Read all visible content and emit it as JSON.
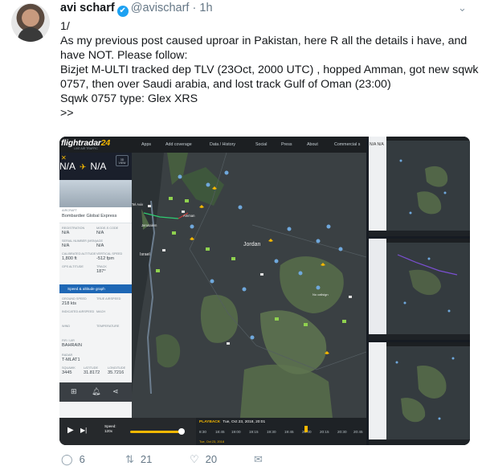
{
  "tweet": {
    "author_name": "avi scharf",
    "verified_glyph": "✔",
    "handle": "@avischarf",
    "separator": "·",
    "time": "1h",
    "caret_icon": "chevron-down-icon",
    "lines": [
      "1/",
      "As my previous post caused uproar in Pakistan, here R all the details i have, and",
      "have NOT. Please follow:",
      "Bizjet M-ULTI tracked dep TLV (23Oct, 2000 UTC) , hopped Amman, got new sqwk",
      "0757, then over Saudi arabia, and lost track Gulf of Oman (23:00)",
      "Sqwk 0757 type: Glex XRS",
      ">>"
    ]
  },
  "fr24": {
    "logo_text": "flightradar",
    "logo_num": "24",
    "tagline": "LIVE AIR TRAFFIC",
    "menu": [
      "Apps",
      "Add coverage",
      "Data / History",
      "Social",
      "Press",
      "About",
      "Commercial s"
    ],
    "map_labels": {
      "jordan": "Jordan",
      "amman": "Amman",
      "tel_aviv": "Tel Aviv",
      "jerusalem": "Jerusalem",
      "israel": "Israel",
      "no_callsign": "No callsign"
    },
    "panel": {
      "close_glyph": "✕",
      "view_3d": "3D VIEW",
      "origin": "N/A",
      "destination": "N/A",
      "arrow_glyph": "✈",
      "aircraft_label": "AIRCRAFT",
      "aircraft": "Bombardier Global Express",
      "fields": [
        {
          "label": "REGISTRATION",
          "value": "N/A"
        },
        {
          "label": "MODE-S CODE",
          "value": "N/A"
        },
        {
          "label": "SERIAL NUMBER (MSN)",
          "value": "N/A"
        },
        {
          "label": "AGE",
          "value": "N/A"
        },
        {
          "label": "CALIBRATED ALTITUDE",
          "value": "1,800 ft"
        },
        {
          "label": "VERTICAL SPEED",
          "value": "-512 fpm"
        },
        {
          "label": "GPS ALTITUDE",
          "value": ""
        },
        {
          "label": "TRACK",
          "value": "187°"
        }
      ],
      "speed_bar": "Speed & altitude graph",
      "ground_speed_label": "GROUND SPEED",
      "ground_speed": "218 kts",
      "true_airspeed_label": "TRUE AIRSPEED",
      "indicated_label": "INDICATED AIRSPEED",
      "mach_label": "MACH",
      "wind_label": "WIND",
      "temperature_label": "TEMPERATURE",
      "fir_label": "FIR / UIR",
      "fir_value": "BAHRAIN",
      "radar_label": "RADAR",
      "radar_value": "T-MLAT1",
      "squawk_label": "SQUAWK",
      "squawk": "3445",
      "latitude_label": "LATITUDE",
      "latitude": "31.8172",
      "longitude_label": "LONGITUDE",
      "longitude": "35.7216",
      "icons": [
        "grid-icon",
        "bell-icon",
        "share-icon"
      ]
    },
    "playback": {
      "play_glyph": "▶",
      "next_glyph": "▶|",
      "speed_label": "Speed:",
      "speed_value": "120x",
      "label": "PLAYBACK",
      "datetime": "Tue, Oct 23, 2018, 20:01",
      "ticks": [
        "8:30",
        "18:45",
        "19:00",
        "19:15",
        "19:30",
        "19:45",
        "20:00",
        "20:15",
        "20:30",
        "20:45"
      ],
      "date_small": "Tue, Oct 23, 2018"
    },
    "thumb_codes": "N/A    N/A"
  },
  "actions": {
    "reply_icon": "reply-icon",
    "reply_count": "6",
    "retweet_icon": "retweet-icon",
    "retweet_count": "21",
    "like_icon": "heart-icon",
    "like_count": "20",
    "message_icon": "envelope-icon"
  },
  "colors": {
    "accent": "#f5b800",
    "twitter_blue": "#1da1f2",
    "map_bg": "#3a4043",
    "land_green": "#586e4a"
  }
}
